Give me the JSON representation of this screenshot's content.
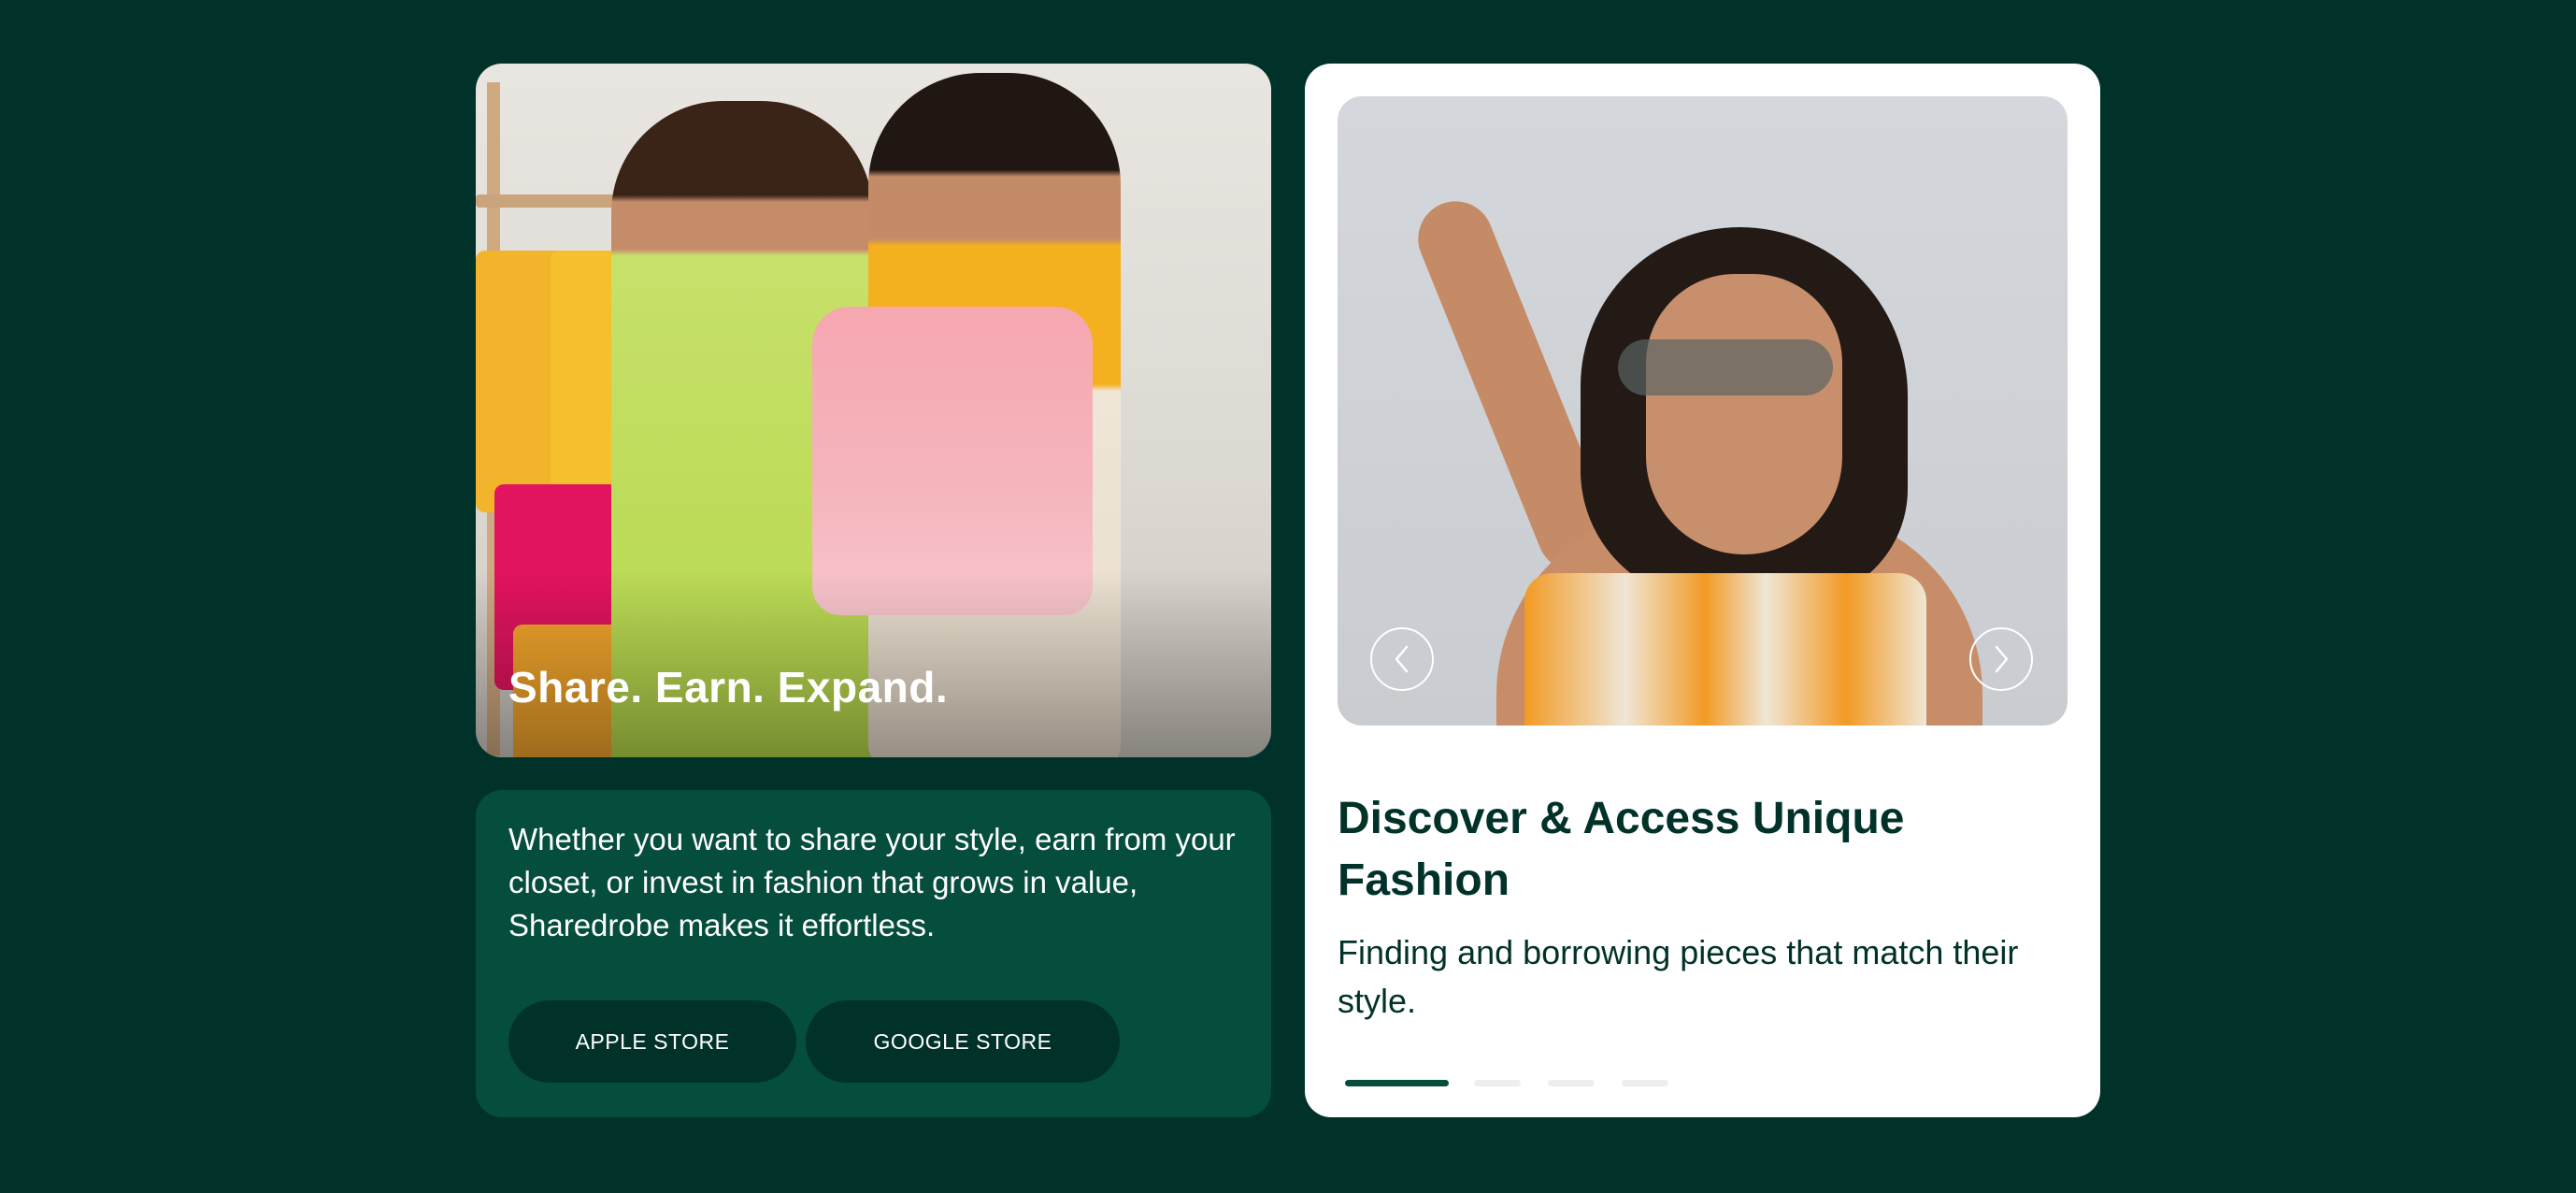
{
  "hero": {
    "title": "Share. Earn. Expand."
  },
  "info": {
    "text": "Whether you want to share your style, earn from your closet, or invest in fashion that grows in value, Sharedrobe makes it effortless.",
    "apple_label": "APPLE STORE",
    "google_label": "GOOGLE STORE"
  },
  "carousel": {
    "title": "Discover & Access Unique Fashion",
    "description": "Finding and borrowing pieces that match their style.",
    "prev_icon": "chevron-left-icon",
    "next_icon": "chevron-right-icon",
    "slide_count": 4,
    "active_slide": 1
  },
  "colors": {
    "page_background": "#01322a",
    "info_card": "#054d3c",
    "button": "#01322a",
    "active_dot": "#054d3c",
    "inactive_dot": "#eeeeee"
  }
}
